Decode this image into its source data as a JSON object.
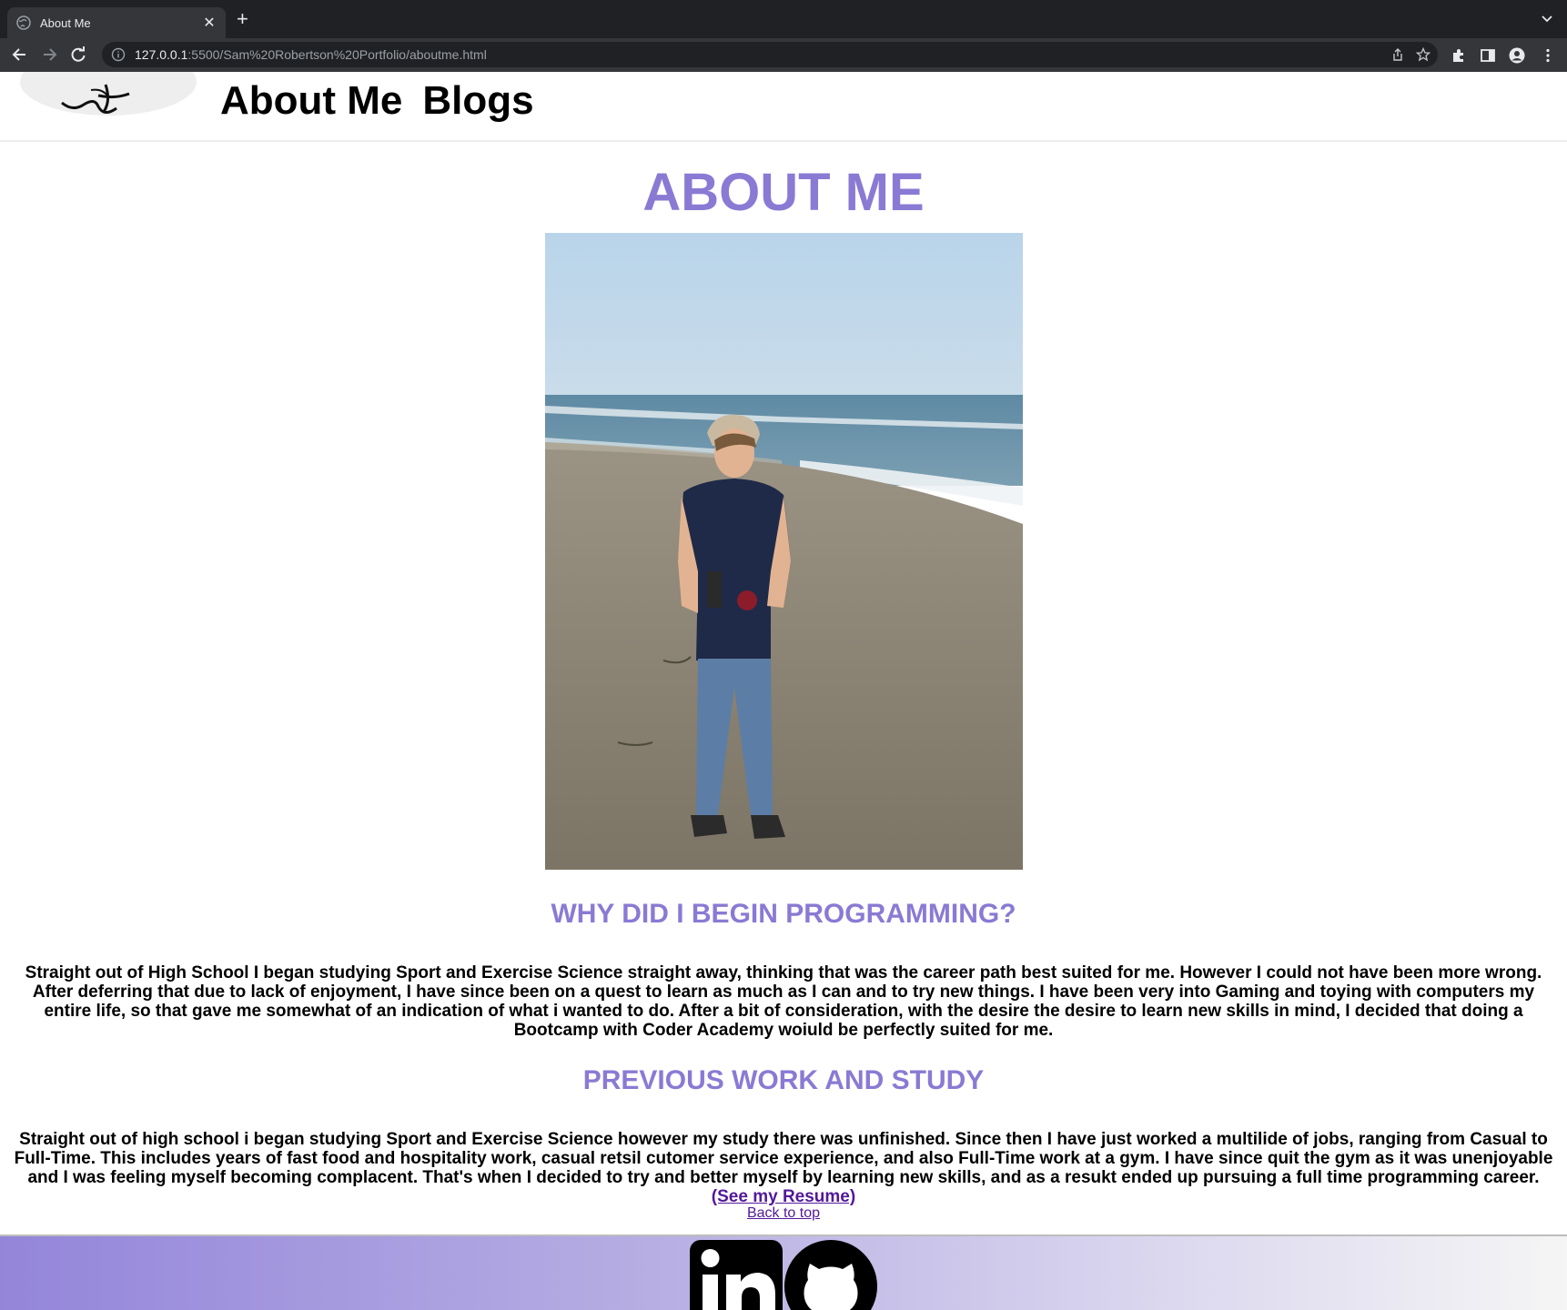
{
  "browser": {
    "tab_title": "About Me",
    "url_host": "127.0.0.1",
    "url_path": ":5500/Sam%20Robertson%20Portfolio/aboutme.html"
  },
  "nav": {
    "about_label": "About Me",
    "blogs_label": "Blogs"
  },
  "main": {
    "title": "ABOUT ME",
    "section1": {
      "heading": "WHY DID I BEGIN PROGRAMMING?",
      "body": "Straight out of High School I began studying Sport and Exercise Science straight away, thinking that was the career path best suited for me. However I could not have been more wrong. After deferring that due to lack of enjoyment, I have since been on a quest to learn as much as I can and to try new things. I have been very into Gaming and toying with computers my entire life, so that gave me somewhat of an indication of what i wanted to do. After a bit of consideration, with the desire the desire to learn new skills in mind, I decided that doing a Bootcamp with Coder Academy woiuld be perfectly suited for me."
    },
    "section2": {
      "heading": "PREVIOUS WORK AND STUDY",
      "body": "Straight out of high school i began studying Sport and Exercise Science however my study there was unfinished. Since then I have just worked a multilide of jobs, ranging from Casual to Full-Time. This includes years of fast food and hospitality work, casual retsil cutomer service experience, and also Full-Time work at a gym. I have since quit the gym as it was unenjoyable and I was feeling myself becoming complacent. That's when I decided to try and better myself by learning new skills, and as a resukt ended up pursuing a full time programming career.",
      "resume_link": " (See my Resume)"
    },
    "back_to_top": "Back to top"
  },
  "footer": {
    "icons": [
      "linkedin-icon",
      "github-icon"
    ]
  },
  "colors": {
    "accent": "#8a7ad4",
    "link": "#52189a"
  }
}
